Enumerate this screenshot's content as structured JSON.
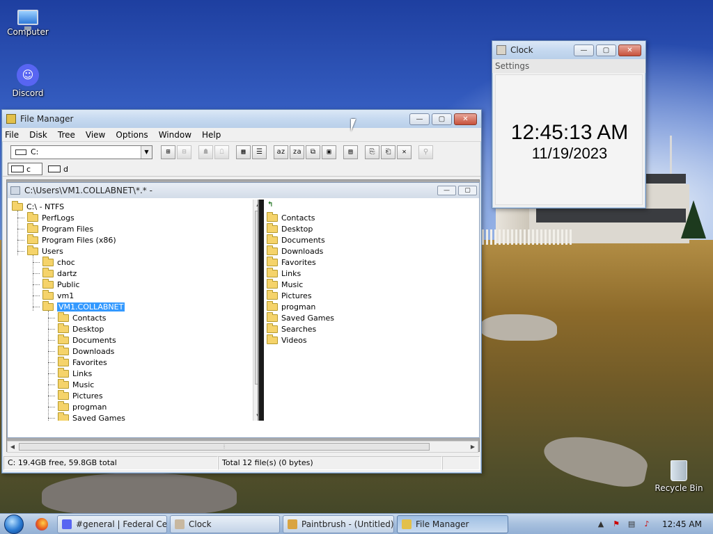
{
  "desktop": {
    "icons": [
      {
        "label": "Computer",
        "icon": "computer-icon"
      },
      {
        "label": "Discord",
        "icon": "discord-icon"
      },
      {
        "label": "Recycle Bin",
        "icon": "recycle-bin-icon"
      }
    ]
  },
  "file_manager": {
    "title": "File Manager",
    "menu": [
      "File",
      "Disk",
      "Tree",
      "View",
      "Options",
      "Window",
      "Help"
    ],
    "drive_select": "C:",
    "drives": [
      "c",
      "d"
    ],
    "toolbar_icons": [
      "connect-drive-icon",
      "disconnect-drive-icon",
      "share-icon",
      "stop-share-icon",
      "large-icons-icon",
      "list-icon",
      "sort-name-icon",
      "sort-type-icon",
      "sort-size-icon",
      "sort-date-icon",
      "new-window-icon",
      "copy-icon",
      "move-icon",
      "delete-icon",
      "properties-icon"
    ],
    "child": {
      "title": "C:\\Users\\VM1.COLLABNET\\*.* -",
      "tree": [
        {
          "label": "C:\\ - NTFS",
          "depth": 0
        },
        {
          "label": "PerfLogs",
          "depth": 1
        },
        {
          "label": "Program Files",
          "depth": 1
        },
        {
          "label": "Program Files (x86)",
          "depth": 1
        },
        {
          "label": "Users",
          "depth": 1
        },
        {
          "label": "choc",
          "depth": 2
        },
        {
          "label": "dartz",
          "depth": 2
        },
        {
          "label": "Public",
          "depth": 2
        },
        {
          "label": "vm1",
          "depth": 2
        },
        {
          "label": "VM1.COLLABNET",
          "depth": 2,
          "selected": true
        },
        {
          "label": "Contacts",
          "depth": 3
        },
        {
          "label": "Desktop",
          "depth": 3
        },
        {
          "label": "Documents",
          "depth": 3
        },
        {
          "label": "Downloads",
          "depth": 3
        },
        {
          "label": "Favorites",
          "depth": 3
        },
        {
          "label": "Links",
          "depth": 3
        },
        {
          "label": "Music",
          "depth": 3
        },
        {
          "label": "Pictures",
          "depth": 3
        },
        {
          "label": "progman",
          "depth": 3
        },
        {
          "label": "Saved Games",
          "depth": 3
        }
      ],
      "files": [
        "Contacts",
        "Desktop",
        "Documents",
        "Downloads",
        "Favorites",
        "Links",
        "Music",
        "Pictures",
        "progman",
        "Saved Games",
        "Searches",
        "Videos"
      ]
    },
    "status": {
      "disk": "C: 19.4GB free,  59.8GB total",
      "files": "Total 12 file(s) (0 bytes)"
    }
  },
  "clock": {
    "title": "Clock",
    "menu": "Settings",
    "time": "12:45:13 AM",
    "date": "11/19/2023"
  },
  "taskbar": {
    "tasks": [
      {
        "label": "#general | Federal Ce...",
        "icon": "discord-icon",
        "color": "#5865f2"
      },
      {
        "label": "Clock",
        "icon": "clock-icon",
        "color": "#c8b8a0"
      },
      {
        "label": "Paintbrush - (Untitled)",
        "icon": "paintbrush-icon",
        "color": "#d9a441"
      },
      {
        "label": "File Manager",
        "icon": "file-manager-icon",
        "color": "#e2c04a",
        "active": true
      }
    ],
    "time": "12:45 AM"
  }
}
